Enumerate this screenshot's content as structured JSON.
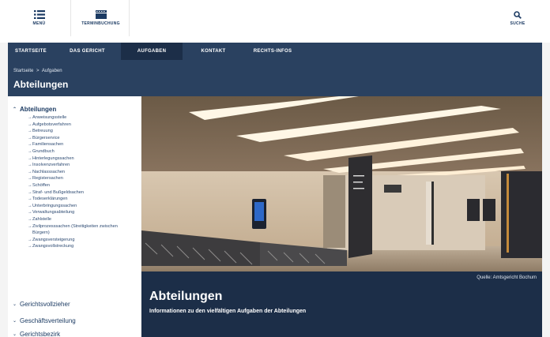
{
  "header": {
    "menu_label": "MENÜ",
    "termin_label": "TERMINBUCHUNG",
    "search_label": "SUCHE"
  },
  "nav": {
    "items": [
      {
        "label": "STARTSEITE",
        "active": false
      },
      {
        "label": "DAS GERICHT",
        "active": false
      },
      {
        "label": "AUFGABEN",
        "active": true
      },
      {
        "label": "KONTAKT",
        "active": false
      },
      {
        "label": "RECHTS-INFOS",
        "active": false
      }
    ]
  },
  "breadcrumb": {
    "home": "Startseite",
    "separator": ">",
    "current": "Aufgaben"
  },
  "page": {
    "title": "Abteilungen"
  },
  "sidebar": {
    "open_section": "Abteilungen",
    "items": [
      "Anweisungsstelle",
      "Aufgebotsverfahren",
      "Betreuung",
      "Bürgerservice",
      "Familiensachen",
      "Grundbuch",
      "Hinterlegungssachen",
      "Insolvenzverfahren",
      "Nachlasssachen",
      "Registersachen",
      "Schöffen",
      "Straf- und Bußgeldsachen",
      "Todeserklärungen",
      "Unterbringungssachen",
      "Verwaltungsabteilung",
      "Zahlstelle",
      "Zivilprozesssachen (Streitigkeiten zwischen Bürgern)",
      "Zwangsversteigerung",
      "Zwangsvollstreckung"
    ],
    "collapsed_sections": [
      "Gerichtsvollzieher",
      "Geschäftsverteilung",
      "Gerichtsbezirk"
    ]
  },
  "hero": {
    "source": "Quelle: Amtsgericht Bochum",
    "title": "Abteilungen",
    "subtitle": "Informationen zu den vielfältigen Aufgaben der Abteilungen"
  },
  "colors": {
    "nav_bg": "#2a4160",
    "nav_active": "#1c2e48",
    "caption_bg": "#1c2e48",
    "link": "#2d4a72"
  }
}
